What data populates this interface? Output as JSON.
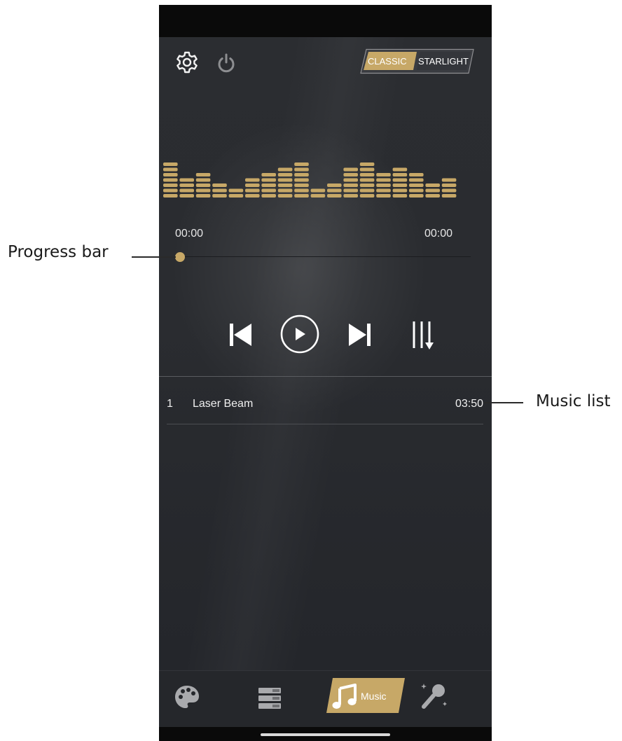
{
  "header": {
    "settings_icon": "gear-icon",
    "power_icon": "power-icon",
    "mode_toggle": {
      "options": [
        "CLASSIC",
        "STARLIGHT"
      ],
      "selected": "CLASSIC"
    }
  },
  "equalizer": {
    "icon": "equalizer-visualizer",
    "levels": [
      6,
      3,
      4,
      2,
      1,
      3,
      4,
      5,
      6,
      1,
      2,
      5,
      6,
      4,
      5,
      4,
      2,
      3
    ],
    "color": "#c7a867"
  },
  "player": {
    "elapsed": "00:00",
    "total": "00:00",
    "progress": 0,
    "controls": {
      "previous_icon": "skip-previous-icon",
      "play_icon": "play-circle-icon",
      "next_icon": "skip-next-icon",
      "play_mode_icon": "sequential-play-icon"
    }
  },
  "music_list": [
    {
      "index": "1",
      "title": "Laser Beam",
      "duration": "03:50"
    }
  ],
  "bottom_nav": {
    "items": [
      {
        "icon": "palette-icon",
        "label": ""
      },
      {
        "icon": "list-icon",
        "label": ""
      },
      {
        "icon": "music-note-icon",
        "label": "Music",
        "active": true
      },
      {
        "icon": "microphone-icon",
        "label": ""
      }
    ]
  },
  "annotations": {
    "progress_bar": "Progress bar",
    "music_list": "Music list"
  },
  "colors": {
    "accent": "#c7a867",
    "background": "#2a2c30",
    "text": "#f0f0f0"
  }
}
